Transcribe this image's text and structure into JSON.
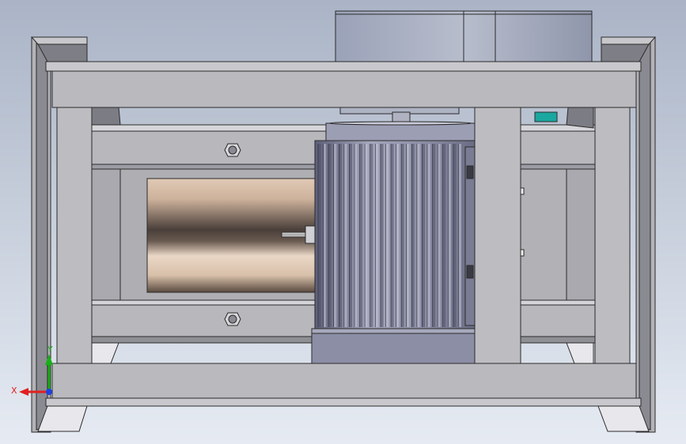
{
  "viewport": {
    "background_top": "#aab4c6",
    "background_bottom": "#e6ebf3"
  },
  "colors": {
    "frame": "#b7b7bc",
    "frame_dark": "#7e7e86",
    "frame_light": "#d2d2d6",
    "motor_body": "#8d8fa8",
    "motor_fin_dark": "#4f5168",
    "motor_fin_light": "#c4c6d8",
    "roller_dark": "#4a3f3a",
    "roller_light": "#ead7c6",
    "outline": "#2b2b2b",
    "accent_teal": "#1aa7a0"
  },
  "triad": {
    "x_label": "X",
    "y_label": "Y",
    "x_color": "#e02020",
    "y_color": "#18b018",
    "z_color": "#2040e0"
  }
}
